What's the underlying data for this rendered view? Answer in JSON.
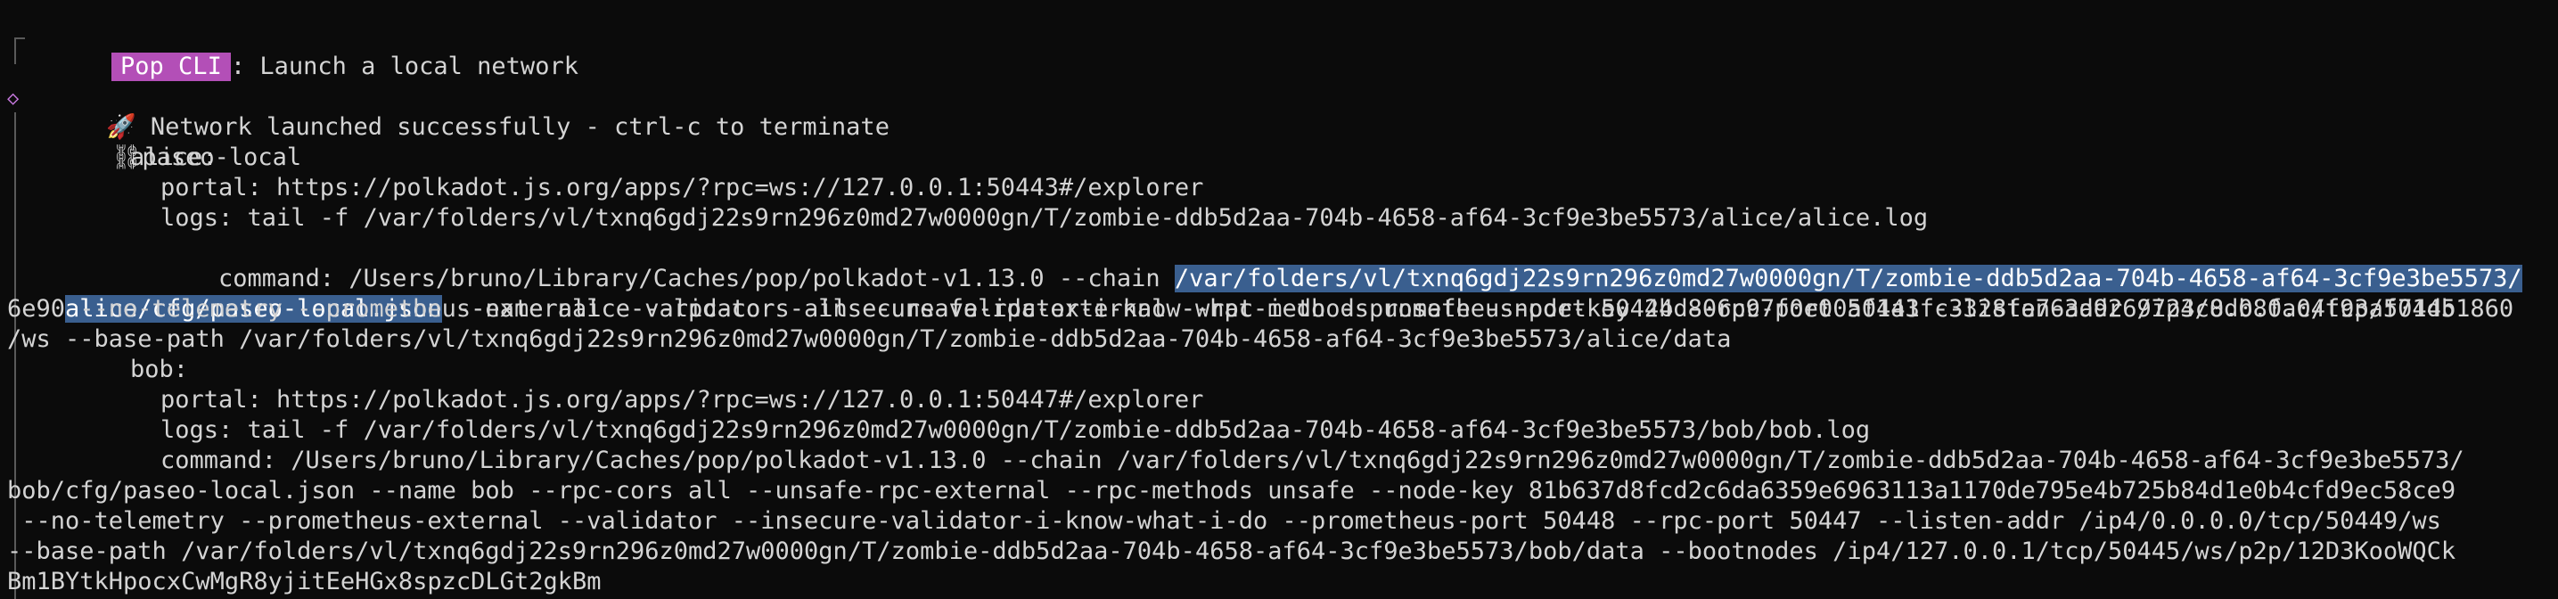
{
  "header": {
    "badge": "Pop CLI",
    "title": ": Launch a local network"
  },
  "status": {
    "rocket_icon": "rocket",
    "message": "Network launched successfully - ctrl-c to terminate"
  },
  "network": {
    "link_icon": "chain-link",
    "name": "paseo-local"
  },
  "nodes": [
    {
      "label": "alice:",
      "portal": "portal: https://polkadot.js.org/apps/?rpc=ws://127.0.0.1:50443#/explorer",
      "logs": "logs: tail -f /var/folders/vl/txnq6gdj22s9rn296z0md27w0000gn/T/zombie-ddb5d2aa-704b-4658-af64-3cf9e3be5573/alice/alice.log",
      "command_prefix": "command: /Users/bruno/Library/Caches/pop/polkadot-v1.13.0 --chain ",
      "command_selected_1": "/var/folders/vl/txnq6gdj22s9rn296z0md27w0000gn/T/zombie-ddb5d2aa-704b-4658-af64-3cf9e3be5573/",
      "command_selected_2": "alice/cfg/paseo-local.json",
      "command_rest_1": " --name alice --rpc-cors all --unsafe-rpc-external --rpc-methods unsafe --node-key 2bd806c97f0e00af1a1fc3328fa763a9269723c8db8fac4f93af71db1860",
      "command_rest_2": "6e90 --no-telemetry --prometheus-external --validator --insecure-validator-i-know-what-i-do --prometheus-port 50444 --rpc-port 50443 --listen-addr /ip4/0.0.0.0/tcp/50445",
      "command_rest_3": "/ws --base-path /var/folders/vl/txnq6gdj22s9rn296z0md27w0000gn/T/zombie-ddb5d2aa-704b-4658-af64-3cf9e3be5573/alice/data"
    },
    {
      "label": "bob:",
      "portal": "portal: https://polkadot.js.org/apps/?rpc=ws://127.0.0.1:50447#/explorer",
      "logs": "logs: tail -f /var/folders/vl/txnq6gdj22s9rn296z0md27w0000gn/T/zombie-ddb5d2aa-704b-4658-af64-3cf9e3be5573/bob/bob.log",
      "command_1": "command: /Users/bruno/Library/Caches/pop/polkadot-v1.13.0 --chain /var/folders/vl/txnq6gdj22s9rn296z0md27w0000gn/T/zombie-ddb5d2aa-704b-4658-af64-3cf9e3be5573/",
      "command_2": "bob/cfg/paseo-local.json --name bob --rpc-cors all --unsafe-rpc-external --rpc-methods unsafe --node-key 81b637d8fcd2c6da6359e6963113a1170de795e4b725b84d1e0b4cfd9ec58ce9",
      "command_3": " --no-telemetry --prometheus-external --validator --insecure-validator-i-know-what-i-do --prometheus-port 50448 --rpc-port 50447 --listen-addr /ip4/0.0.0.0/tcp/50449/ws",
      "command_4": "--base-path /var/folders/vl/txnq6gdj22s9rn296z0md27w0000gn/T/zombie-ddb5d2aa-704b-4658-af64-3cf9e3be5573/bob/data --bootnodes /ip4/127.0.0.1/tcp/50445/ws/p2p/12D3KooWQCk",
      "command_5": "Bm1BYtkHpocxCwMgR8yjitEeHGx8spzcDLGt2gkBm"
    }
  ],
  "colors": {
    "background": "#0b0b0b",
    "text": "#d4d4d4",
    "badge": "#b34fb7",
    "selection": "#3a5f8f",
    "diamond": "#c678dd"
  }
}
